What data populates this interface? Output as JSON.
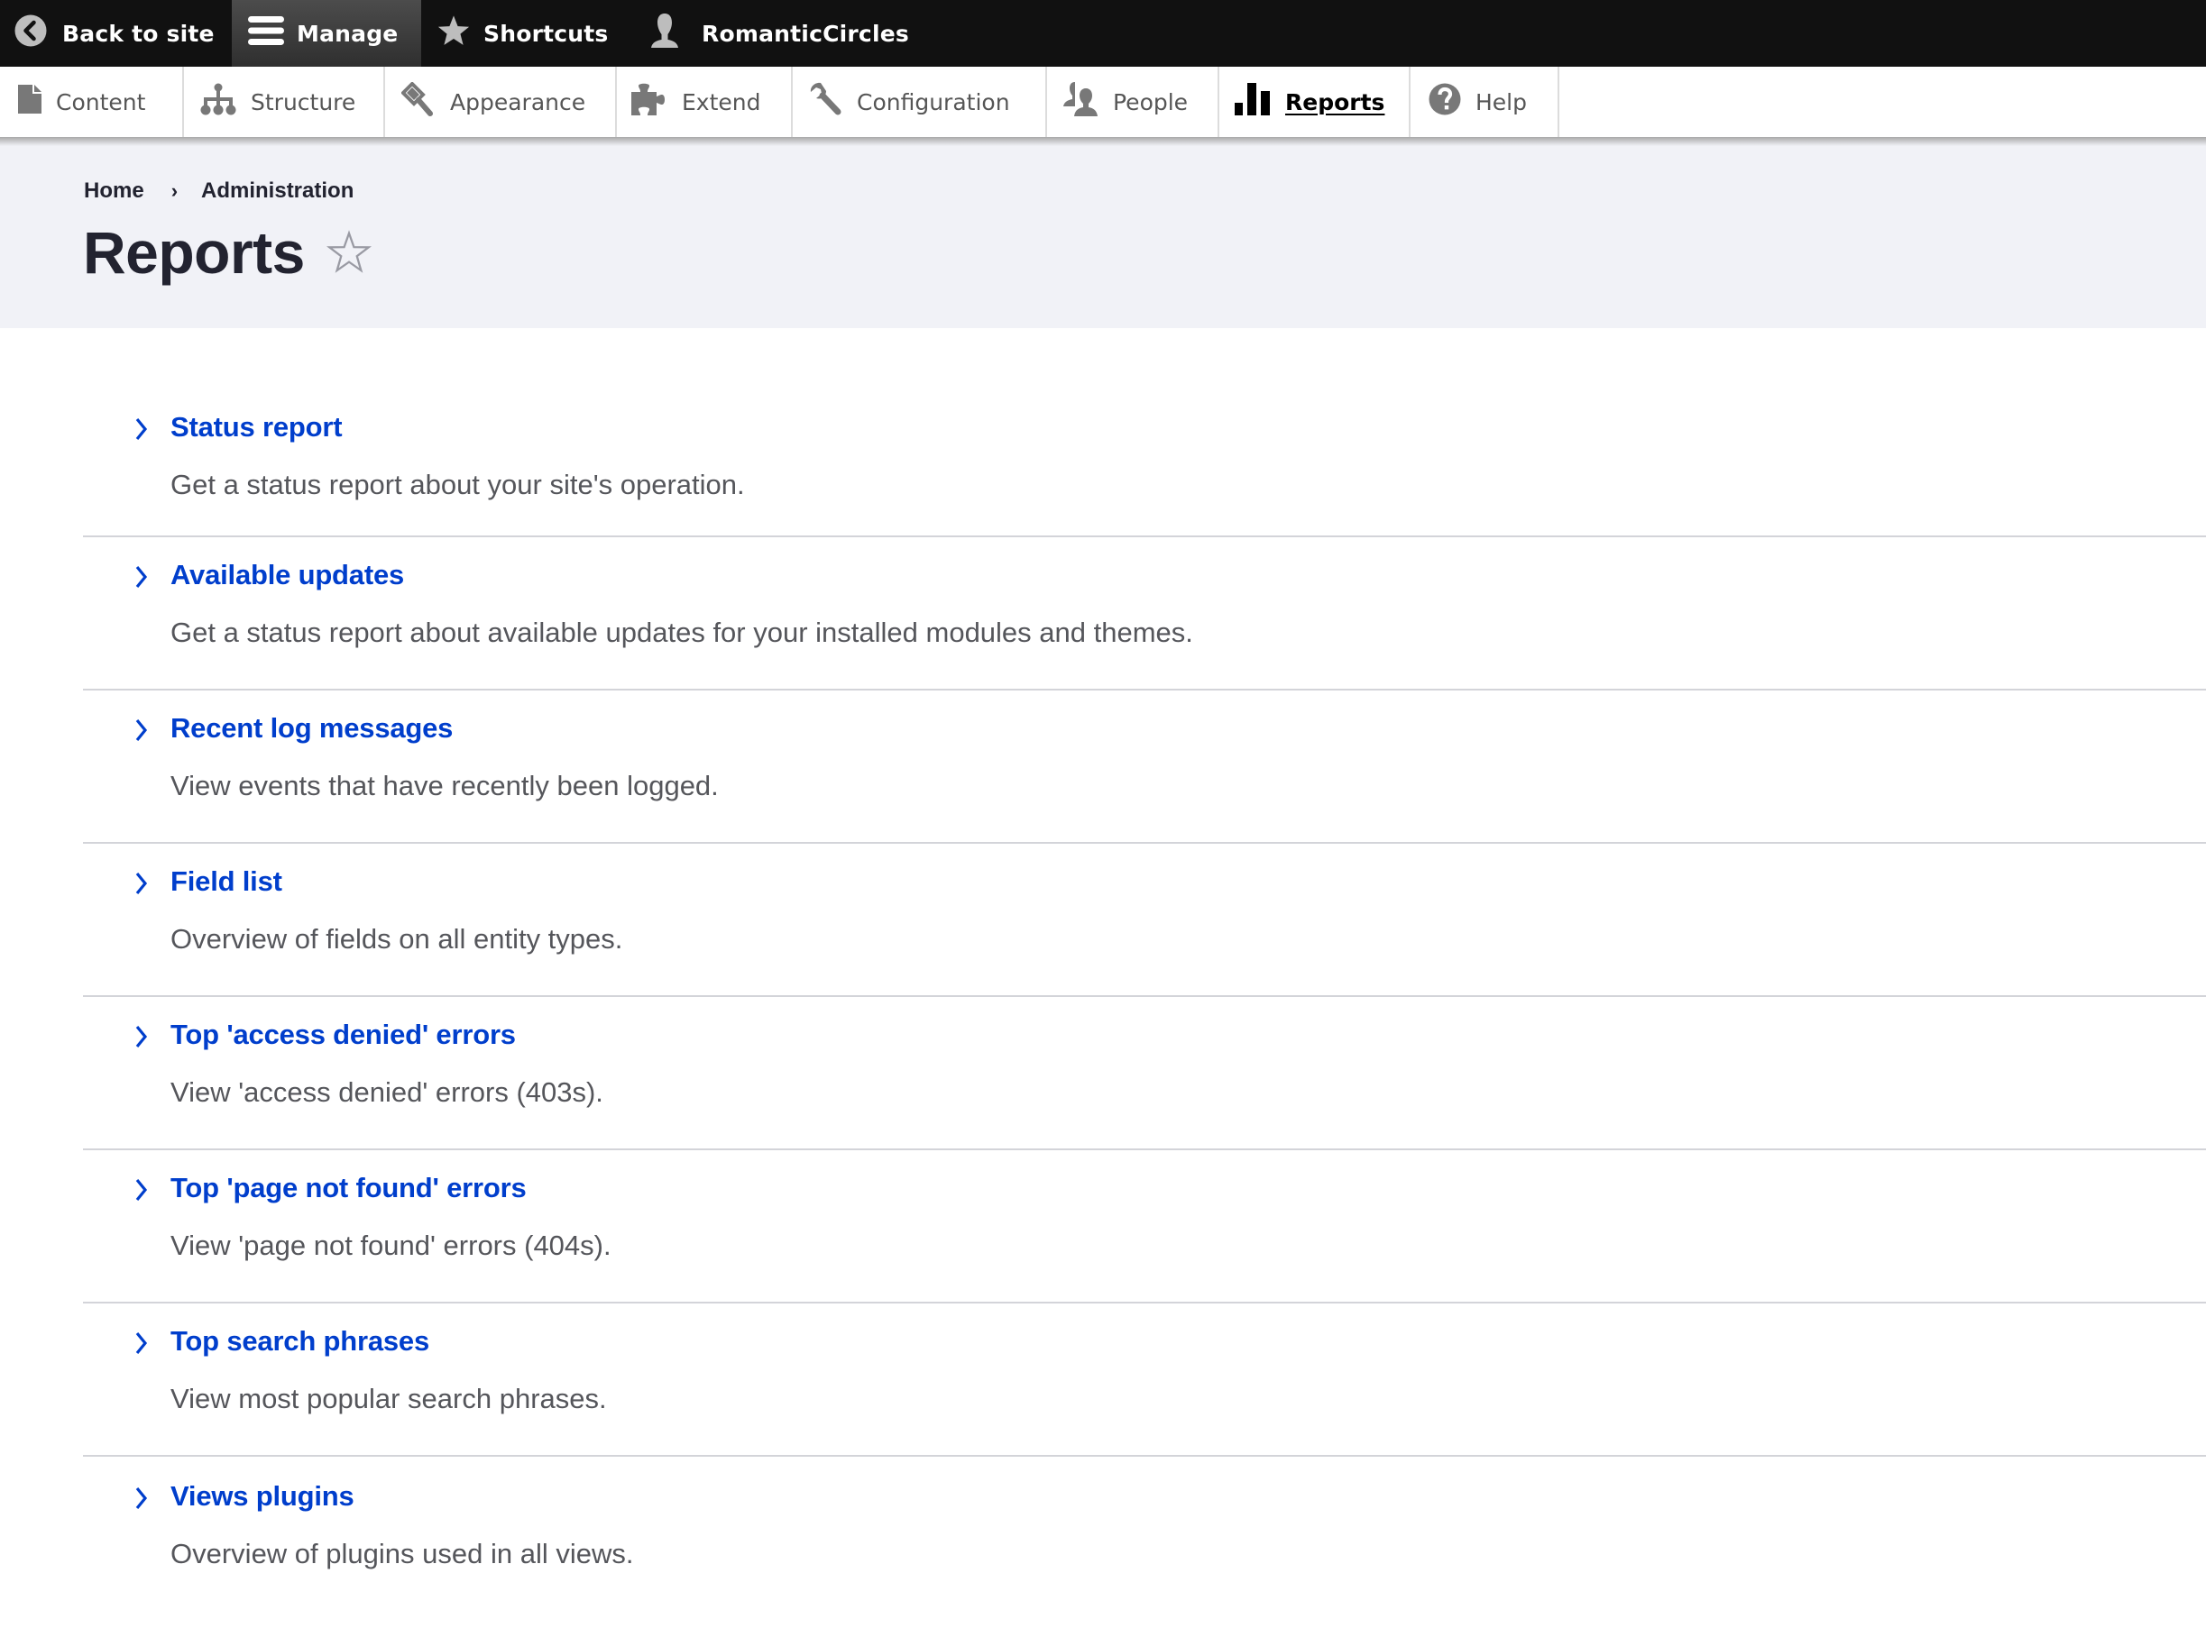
{
  "toolbar": {
    "back_to_site": "Back to site",
    "manage": "Manage",
    "shortcuts": "Shortcuts",
    "user": "RomanticCircles"
  },
  "tray": {
    "tabs": [
      {
        "label": "Content",
        "icon": "file-icon",
        "active": false
      },
      {
        "label": "Structure",
        "icon": "sitemap-icon",
        "active": false
      },
      {
        "label": "Appearance",
        "icon": "paintbrush-icon",
        "active": false
      },
      {
        "label": "Extend",
        "icon": "puzzle-icon",
        "active": false
      },
      {
        "label": "Configuration",
        "icon": "wrench-icon",
        "active": false
      },
      {
        "label": "People",
        "icon": "people-icon",
        "active": false
      },
      {
        "label": "Reports",
        "icon": "bar-chart-icon",
        "active": true
      },
      {
        "label": "Help",
        "icon": "help-icon",
        "active": false
      }
    ]
  },
  "header": {
    "breadcrumb": [
      "Home",
      "Administration"
    ],
    "breadcrumb_separator": "›",
    "title": "Reports"
  },
  "reports": [
    {
      "title": "Status report",
      "description": "Get a status report about your site's operation."
    },
    {
      "title": "Available updates",
      "description": "Get a status report about available updates for your installed modules and themes."
    },
    {
      "title": "Recent log messages",
      "description": "View events that have recently been logged."
    },
    {
      "title": "Field list",
      "description": "Overview of fields on all entity types."
    },
    {
      "title": "Top 'access denied' errors",
      "description": "View 'access denied' errors (403s)."
    },
    {
      "title": "Top 'page not found' errors",
      "description": "View 'page not found' errors (404s)."
    },
    {
      "title": "Top search phrases",
      "description": "View most popular search phrases."
    },
    {
      "title": "Views plugins",
      "description": "Overview of plugins used in all views."
    }
  ],
  "colors": {
    "toolbar_bg": "#111111",
    "header_bg": "#f1f2f7",
    "link": "#003ecc",
    "text": "#222330",
    "description": "#55565b"
  }
}
